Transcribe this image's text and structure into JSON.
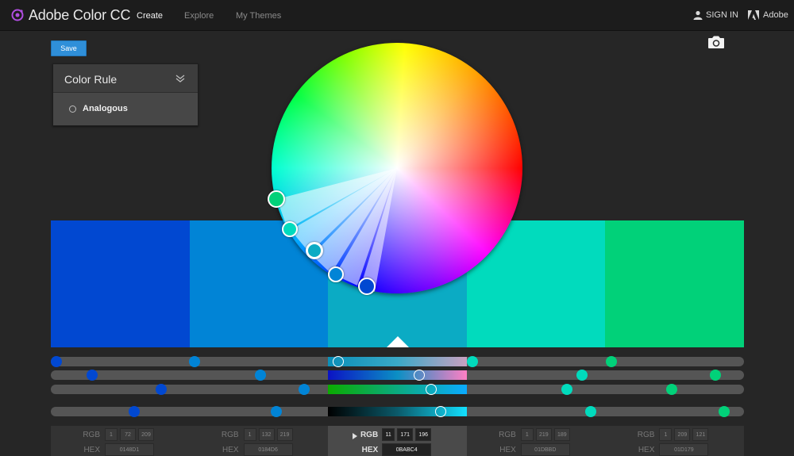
{
  "app": {
    "title": "Adobe Color CC"
  },
  "nav": {
    "create": "Create",
    "explore": "Explore",
    "my_themes": "My Themes",
    "sign_in": "SIGN IN",
    "adobe": "Adobe"
  },
  "toolbar": {
    "save_label": "Save",
    "camera_icon": "camera-icon"
  },
  "color_rule": {
    "title": "Color Rule",
    "selected": "Analogous"
  },
  "swatches": [
    {
      "hex": "#0148D1",
      "rgb": [
        1,
        72,
        209
      ]
    },
    {
      "hex": "#0184D6",
      "rgb": [
        1,
        132,
        219
      ]
    },
    {
      "hex": "#0BABC4",
      "rgb": [
        11,
        171,
        196
      ],
      "active": true
    },
    {
      "hex": "#01DBBD",
      "rgb": [
        1,
        219,
        189
      ]
    },
    {
      "hex": "#01D179",
      "rgb": [
        1,
        209,
        121
      ]
    }
  ],
  "values_panel": {
    "rgb_label": "RGB",
    "hex_label": "HEX",
    "columns": [
      {
        "rgb": [
          "1",
          "72",
          "209"
        ],
        "hex": "0148D1"
      },
      {
        "rgb": [
          "1",
          "132",
          "219"
        ],
        "hex": "0184D6"
      },
      {
        "rgb": [
          "11",
          "171",
          "196"
        ],
        "hex": "0BABC4"
      },
      {
        "rgb": [
          "1",
          "219",
          "189"
        ],
        "hex": "01DBBD"
      },
      {
        "rgb": [
          "1",
          "209",
          "121"
        ],
        "hex": "01D179"
      }
    ]
  }
}
